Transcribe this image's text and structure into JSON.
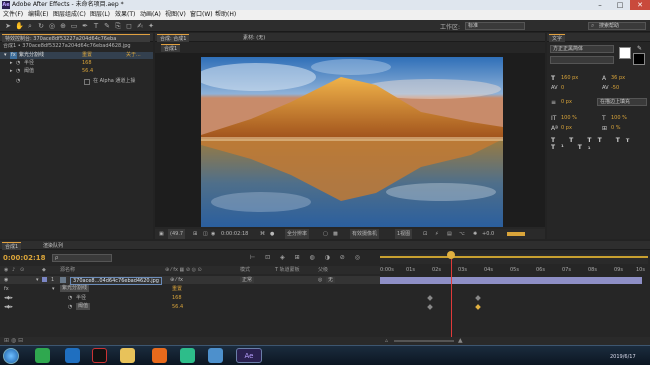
{
  "window": {
    "app_title": "Adobe After Effects - 未命名项目.aep *",
    "min": "–",
    "max": "□",
    "close": "✕"
  },
  "menu": [
    "文件(F)",
    "编辑(E)",
    "图层组成(C)",
    "图层(L)",
    "效果(T)",
    "动画(A)",
    "视图(V)",
    "窗口(W)",
    "帮助(H)"
  ],
  "toolbar": {
    "workspace_label": "工作区:",
    "workspace_value": "标准",
    "search_placeholder": "搜索帮助"
  },
  "effects_panel": {
    "tab_label": "特效控制台: 370ace8df53227a204d64c76eba",
    "breadcrumb": "合成1 • 370ace8df53227a204d64c76ebad4628.jpg",
    "effect_name": "紫光分割线",
    "reset": "重置",
    "about": "关于...",
    "params": [
      {
        "name": "半径",
        "value": "168"
      },
      {
        "name": "阈值",
        "value": "56.4"
      }
    ],
    "option_label": "在 Alpha 通道上操"
  },
  "comp_panel": {
    "tab_label": "合成: 合成1",
    "layer_tab": "素材: (无)",
    "subtab": "合成1",
    "zoom": "(49.7",
    "timecode": "0:00:02:18",
    "resolution": "全分辨率",
    "camera": "有效摄像机",
    "views": "1视图",
    "exposure": "+0.0"
  },
  "char_panel": {
    "tab_label": "文字",
    "font": "方正正黑简体",
    "style": "",
    "size": "160 px",
    "leading": "36 px",
    "tracking": "0",
    "kerning": "-50",
    "stroke": "0 px",
    "stroke_mode": "在描边上填充",
    "vscale": "100 %",
    "hscale": "100 %",
    "baseline": "0 px",
    "tsume": "0 %"
  },
  "timeline": {
    "tabs": [
      "合成1",
      "渲染队列"
    ],
    "timecode": "0:00:02:18",
    "search_placeholder": "ρ",
    "header_source": "源名称",
    "header_mode": "模式",
    "header_trkmat": "T  轨道蒙板",
    "header_parent": "父级",
    "layer_number": "1",
    "layer_name": "370ace8...04d64c76ebad4620.jpg",
    "layer_mode": "正常",
    "layer_parent": "无",
    "effect_name": "紫光分割线",
    "effect_reset": "重置",
    "params": [
      {
        "name": "半径",
        "value": "168"
      },
      {
        "name": "阈值",
        "value": "56.4"
      }
    ],
    "ruler": [
      "0:00s",
      "01s",
      "02s",
      "03s",
      "04s",
      "05s",
      "06s",
      "07s",
      "08s",
      "09s",
      "10s"
    ]
  },
  "taskbar": {
    "date": "2019/6/17"
  }
}
